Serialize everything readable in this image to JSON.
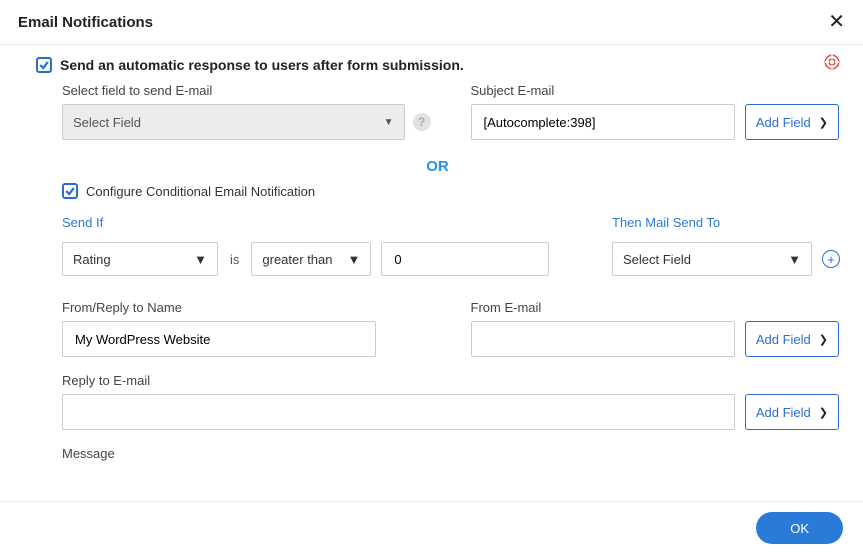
{
  "header": {
    "title": "Email Notifications"
  },
  "auto": {
    "checkbox_label": "Send an automatic response to users after form submission.",
    "select_field_label": "Select field to send E-mail",
    "select_field_value": "Select Field",
    "subject_label": "Subject E-mail",
    "subject_value": "[Autocomplete:398]",
    "add_field": "Add Field"
  },
  "or_label": "OR",
  "cond": {
    "checkbox_label": "Configure Conditional Email Notification",
    "send_if_label": "Send If",
    "is_label": "is",
    "field_value": "Rating",
    "operator_value": "greater than",
    "compare_value": "0",
    "then_label": "Then Mail Send To",
    "then_value": "Select Field"
  },
  "from": {
    "name_label": "From/Reply to Name",
    "name_value": "My WordPress Website",
    "email_label": "From E-mail",
    "email_value": "",
    "add_field": "Add Field"
  },
  "replyto": {
    "label": "Reply to E-mail",
    "value": "",
    "add_field": "Add Field"
  },
  "message": {
    "label": "Message"
  },
  "footer": {
    "ok": "OK"
  }
}
